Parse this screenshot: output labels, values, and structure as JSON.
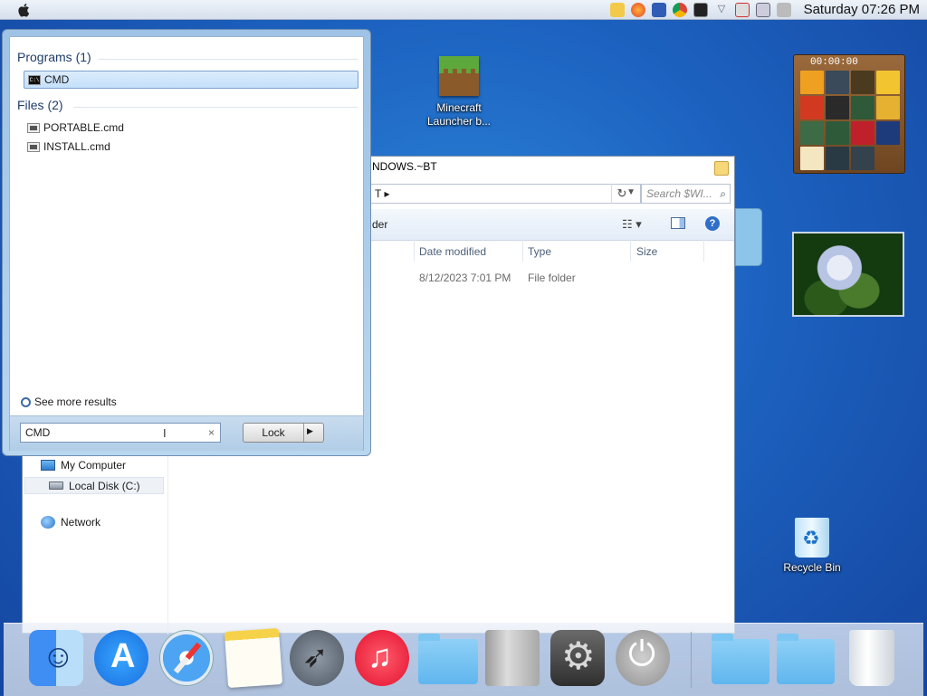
{
  "menubar": {
    "clock": "Saturday 07:26 PM",
    "tray_icons": [
      "folder-icon",
      "firefox-icon",
      "antivirus-icon",
      "chrome-icon",
      "terminal-icon",
      "network-warning-icon",
      "display-icon",
      "volume-muted-icon"
    ]
  },
  "desktop": {
    "minecraft_label": "Minecraft\nLauncher b...",
    "recycle_label": "Recycle Bin",
    "puzzle_timer": "00:00:00"
  },
  "explorer": {
    "title": "NDOWS.~BT",
    "address": "T ▸",
    "search_placeholder": "Search $WI...",
    "toolbar_label": "der",
    "columns": {
      "date": "Date modified",
      "type": "Type",
      "size": "Size"
    },
    "row": {
      "date": "8/12/2023 7:01 PM",
      "type": "File folder"
    },
    "nav": {
      "computer": "My Computer",
      "disk": "Local Disk (C:)",
      "network": "Network"
    }
  },
  "start": {
    "programs_header": "Programs (1)",
    "files_header": "Files (2)",
    "program_results": [
      "CMD"
    ],
    "file_results": [
      "PORTABLE.cmd",
      "INSTALL.cmd"
    ],
    "see_more": "See more results",
    "search_value": "CMD",
    "lock_label": "Lock"
  },
  "dock": {
    "items": [
      "finder",
      "app-store",
      "safari",
      "notes",
      "launchpad",
      "music",
      "documents-folder",
      "mac-pro",
      "system-preferences",
      "power",
      "downloads-folder",
      "files-folder",
      "trash"
    ]
  }
}
